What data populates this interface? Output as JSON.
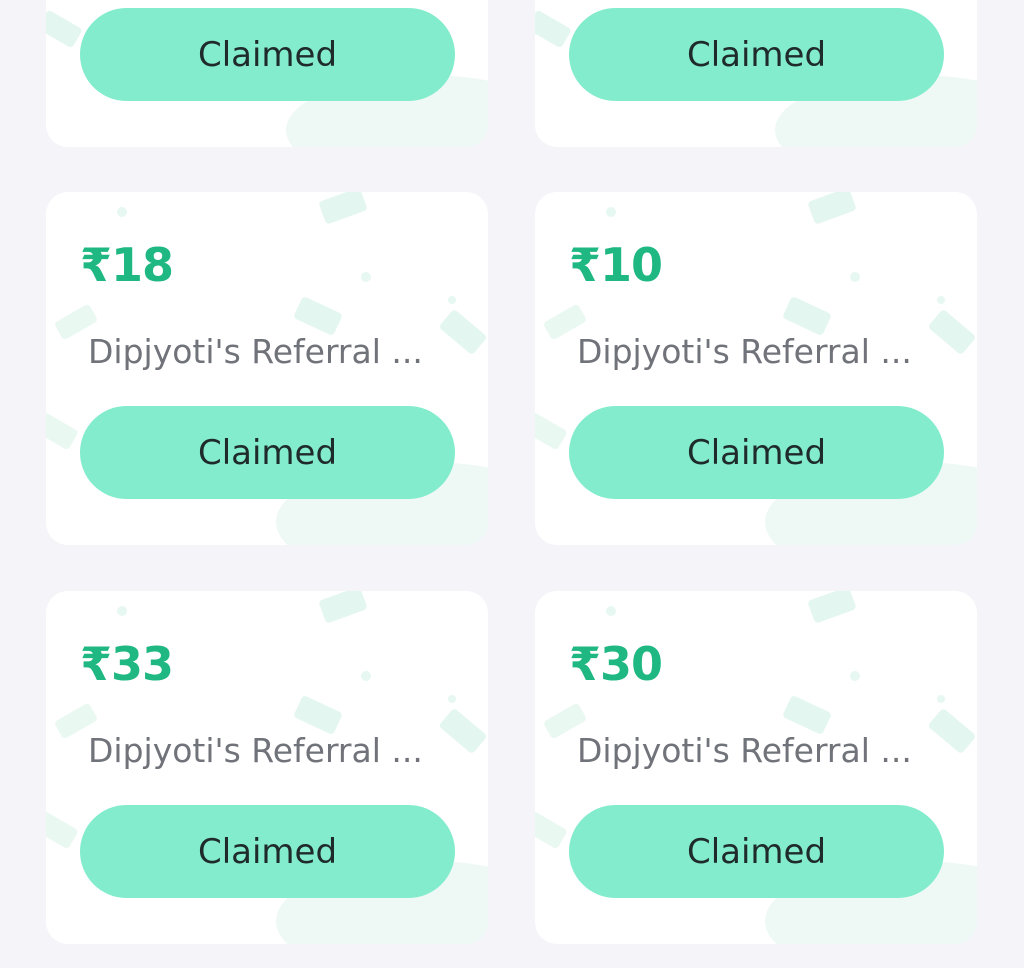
{
  "colors": {
    "page_background": "#f4f4f9",
    "card_background": "#ffffff",
    "amount_color": "#1fb882",
    "button_background": "#82eccc",
    "button_text": "#1f2a2a",
    "description_color": "#707379"
  },
  "rewards": [
    {
      "amount": "",
      "description": "",
      "status_label": "Claimed"
    },
    {
      "amount": "",
      "description": "",
      "status_label": "Claimed"
    },
    {
      "amount": "₹18",
      "description": "Dipjyoti's Referral ...",
      "status_label": "Claimed"
    },
    {
      "amount": "₹10",
      "description": "Dipjyoti's Referral ...",
      "status_label": "Claimed"
    },
    {
      "amount": "₹33",
      "description": "Dipjyoti's Referral ...",
      "status_label": "Claimed"
    },
    {
      "amount": "₹30",
      "description": "Dipjyoti's Referral ...",
      "status_label": "Claimed"
    }
  ]
}
